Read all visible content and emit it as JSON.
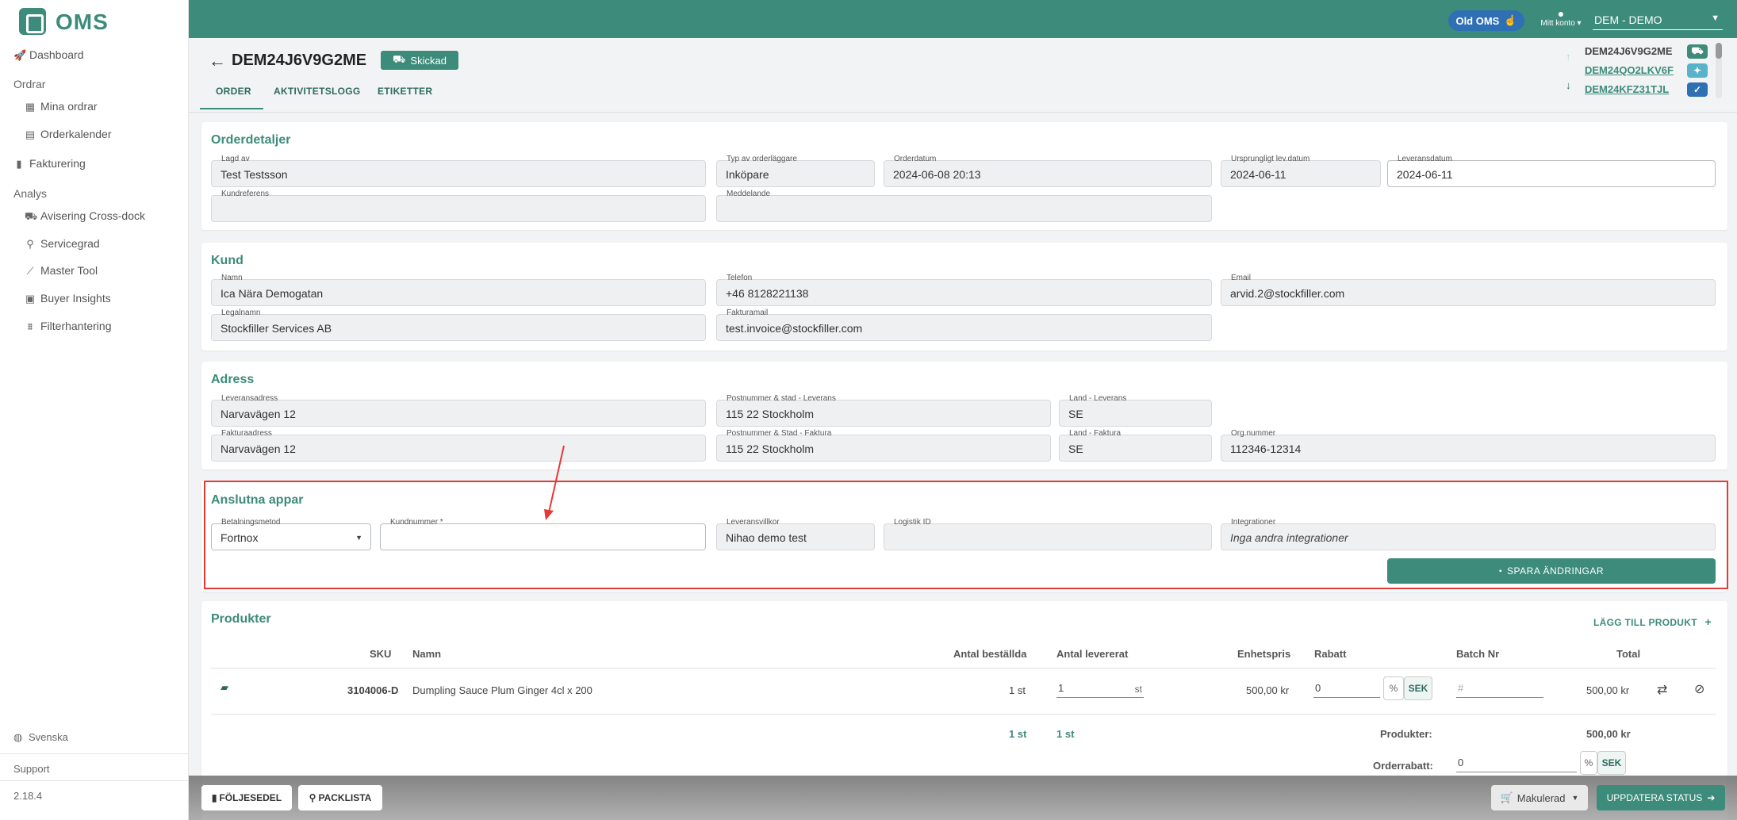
{
  "app": {
    "logo_text": "OMS",
    "version": "2.18.4",
    "language": "Svenska",
    "support": "Support"
  },
  "sidebar": {
    "dashboard": "Dashboard",
    "ordrar_head": "Ordrar",
    "mina_ordrar": "Mina ordrar",
    "orderkalender": "Orderkalender",
    "fakturering": "Fakturering",
    "analys_head": "Analys",
    "avisering": "Avisering Cross-dock",
    "servicegrad": "Servicegrad",
    "master_tool": "Master Tool",
    "buyer_insights": "Buyer Insights",
    "filterhantering": "Filterhantering"
  },
  "topbar": {
    "old_oms": "Old OMS",
    "account": "Mitt konto",
    "org": "DEM - DEMO"
  },
  "header": {
    "order_id": "DEM24J6V9G2ME",
    "status": "Skickad",
    "tabs": [
      "ORDER",
      "AKTIVITETSLOGG",
      "ETIKETTER"
    ],
    "related": [
      {
        "id": "DEM24J6V9G2ME"
      },
      {
        "id": "DEM24QO2LKV6F"
      },
      {
        "id": "DEM24KFZ31TJL"
      }
    ]
  },
  "orderdetaljer": {
    "title": "Orderdetaljer",
    "lagd_av": {
      "label": "Lagd av",
      "value": "Test Testsson"
    },
    "typ": {
      "label": "Typ av orderläggare",
      "value": "Inköpare"
    },
    "orderdatum": {
      "label": "Orderdatum",
      "value": "2024-06-08 20:13"
    },
    "urspr": {
      "label": "Ursprungligt lev.datum",
      "value": "2024-06-11"
    },
    "leveransdatum": {
      "label": "Leveransdatum",
      "value": "2024-06-11"
    },
    "kundreferens": {
      "label": "Kundreferens",
      "value": ""
    },
    "meddelande": {
      "label": "Meddelande",
      "value": ""
    }
  },
  "kund": {
    "title": "Kund",
    "namn": {
      "label": "Namn",
      "value": "Ica Nära Demogatan"
    },
    "telefon": {
      "label": "Telefon",
      "value": "+46 8128221138"
    },
    "email": {
      "label": "Email",
      "value": "arvid.2@stockfiller.com"
    },
    "legalnamn": {
      "label": "Legalnamn",
      "value": "Stockfiller Services AB"
    },
    "fakturamail": {
      "label": "Fakturamail",
      "value": "test.invoice@stockfiller.com"
    }
  },
  "adress": {
    "title": "Adress",
    "lev_adress": {
      "label": "Leveransadress",
      "value": "Narvavägen 12"
    },
    "lev_post": {
      "label": "Postnummer & stad - Leverans",
      "value": "115 22 Stockholm"
    },
    "lev_land": {
      "label": "Land - Leverans",
      "value": "SE"
    },
    "fakt_adress": {
      "label": "Fakturaadress",
      "value": "Narvavägen 12"
    },
    "fakt_post": {
      "label": "Postnummer & Stad - Faktura",
      "value": "115 22 Stockholm"
    },
    "fakt_land": {
      "label": "Land - Faktura",
      "value": "SE"
    },
    "orgnr": {
      "label": "Org.nummer",
      "value": "112346-12314"
    }
  },
  "appar": {
    "title": "Anslutna appar",
    "betalning": {
      "label": "Betalningsmetod",
      "value": "Fortnox"
    },
    "kundnummer": {
      "label": "Kundnummer *",
      "value": ""
    },
    "villkor": {
      "label": "Leveransvillkor",
      "value": "Nihao demo test"
    },
    "logistik": {
      "label": "Logistik ID",
      "value": ""
    },
    "integrationer": {
      "label": "Integrationer",
      "value": "Inga andra integrationer"
    },
    "save": "SPARA ÄNDRINGAR"
  },
  "produkter": {
    "title": "Produkter",
    "add": "LÄGG TILL PRODUKT",
    "columns": [
      "SKU",
      "Namn",
      "Antal beställda",
      "Antal levererat",
      "Enhetspris",
      "Rabatt",
      "Batch Nr",
      "Total"
    ],
    "rows": [
      {
        "sku": "3104006-D",
        "namn": "Dumpling Sauce Plum Ginger 4cl x 200",
        "bestallda": "1 st",
        "levererat": "1",
        "unit": "st",
        "pris": "500,00 kr",
        "rabatt": "0",
        "pct": "%",
        "cur": "SEK",
        "batch_ph": "#",
        "total": "500,00 kr"
      }
    ],
    "sum_bestallda": "1 st",
    "sum_levererat": "1 st",
    "produkter_label": "Produkter:",
    "produkter_value": "500,00 kr",
    "orderrabatt_label": "Orderrabatt:",
    "orderrabatt_value": "0",
    "orderrabatt_pct": "%",
    "orderrabatt_cur": "SEK"
  },
  "footer": {
    "foljesedel": "FÖLJESEDEL",
    "packlista": "PACKLISTA",
    "makulerad": "Makulerad",
    "uppdatera": "UPPDATERA STATUS"
  },
  "colors": {
    "brand": "#3d8b7b",
    "annotation": "#e53935"
  }
}
